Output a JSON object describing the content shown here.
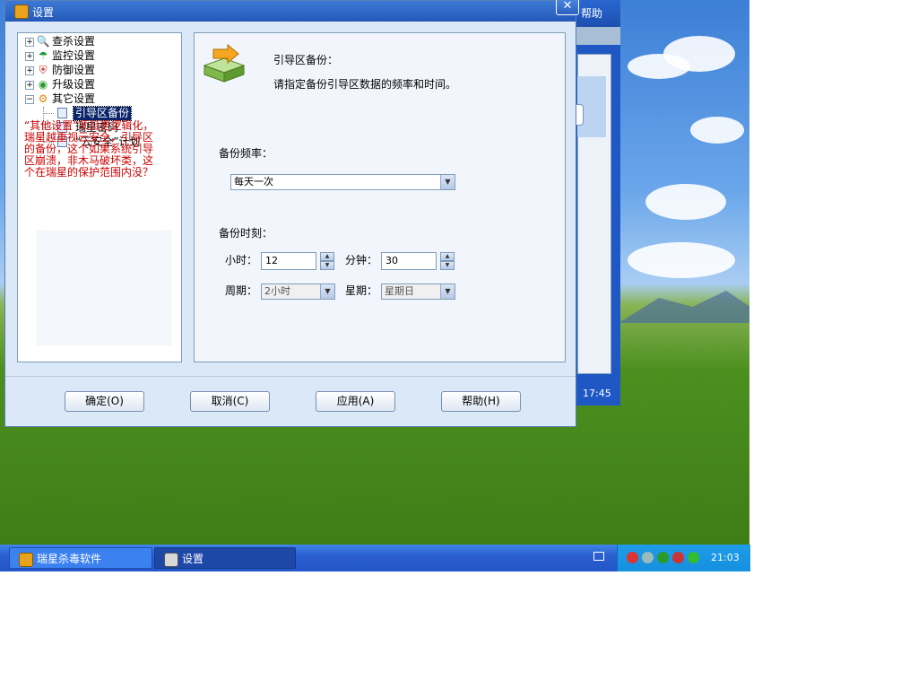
{
  "dialog": {
    "title": "设置",
    "close_glyph": "✕"
  },
  "background_window": {
    "help_label": "帮助",
    "time": "17:45"
  },
  "tree": {
    "items": [
      {
        "label": "查杀设置",
        "expander": "+",
        "icon": "scan-settings-icon"
      },
      {
        "label": "监控设置",
        "expander": "+",
        "icon": "monitor-umbrella-icon"
      },
      {
        "label": "防御设置",
        "expander": "+",
        "icon": "defense-shield-icon"
      },
      {
        "label": "升级设置",
        "expander": "+",
        "icon": "upgrade-globe-icon"
      },
      {
        "label": "其它设置",
        "expander": "−",
        "icon": "other-gear-icon"
      }
    ],
    "children": [
      {
        "label": "引导区备份",
        "selected": true
      },
      {
        "label": "瑞星密码",
        "selected": false
      },
      {
        "label": "“云安全”计划",
        "selected": false
      }
    ],
    "note": "“其他设置”项目更逻辑化，瑞星越重视云安全，引导区的备份，这个如果系统引导区崩溃，非木马破坏类，这个在瑞星的保护范围内没？"
  },
  "panel": {
    "heading": "引导区备份：",
    "description": "请指定备份引导区数据的频率和时间。",
    "frequency_label": "备份频率：",
    "frequency_value": "每天一次",
    "time_label": "备份时刻：",
    "hour_label": "小时：",
    "hour_value": "12",
    "minute_label": "分钟：",
    "minute_value": "30",
    "period_label": "周期：",
    "period_value": "2小时",
    "weekday_label": "星期：",
    "weekday_value": "星期日"
  },
  "buttons": {
    "ok": "确定(O)",
    "cancel": "取消(C)",
    "apply": "应用(A)",
    "help": "帮助(H)"
  },
  "taskbar": {
    "tasks": [
      {
        "label": "瑞星杀毒软件"
      },
      {
        "label": "设置"
      }
    ],
    "clock": "21:03"
  },
  "colors": {
    "selection": "#0a246a",
    "note_text": "#cc0000",
    "taskbar": "#2456c8"
  }
}
